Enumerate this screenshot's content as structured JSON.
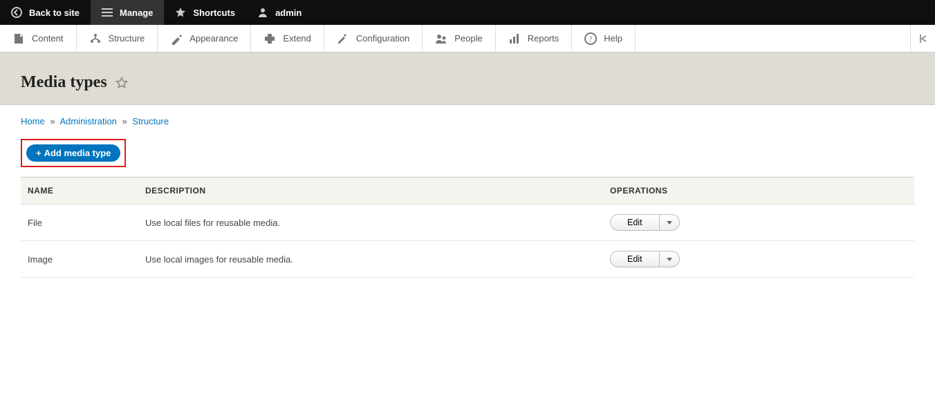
{
  "toolbar_top": {
    "back_to_site": "Back to site",
    "manage": "Manage",
    "shortcuts": "Shortcuts",
    "user": "admin"
  },
  "toolbar_sub": [
    {
      "key": "content",
      "label": "Content"
    },
    {
      "key": "structure",
      "label": "Structure"
    },
    {
      "key": "appearance",
      "label": "Appearance"
    },
    {
      "key": "extend",
      "label": "Extend"
    },
    {
      "key": "configuration",
      "label": "Configuration"
    },
    {
      "key": "people",
      "label": "People"
    },
    {
      "key": "reports",
      "label": "Reports"
    },
    {
      "key": "help",
      "label": "Help"
    }
  ],
  "page": {
    "title": "Media types",
    "add_button": "Add media type"
  },
  "breadcrumb": {
    "home": "Home",
    "administration": "Administration",
    "structure": "Structure"
  },
  "table": {
    "headers": {
      "name": "NAME",
      "description": "DESCRIPTION",
      "operations": "OPERATIONS"
    },
    "rows": [
      {
        "name": "File",
        "description": "Use local files for reusable media.",
        "op": "Edit"
      },
      {
        "name": "Image",
        "description": "Use local images for reusable media.",
        "op": "Edit"
      }
    ]
  }
}
